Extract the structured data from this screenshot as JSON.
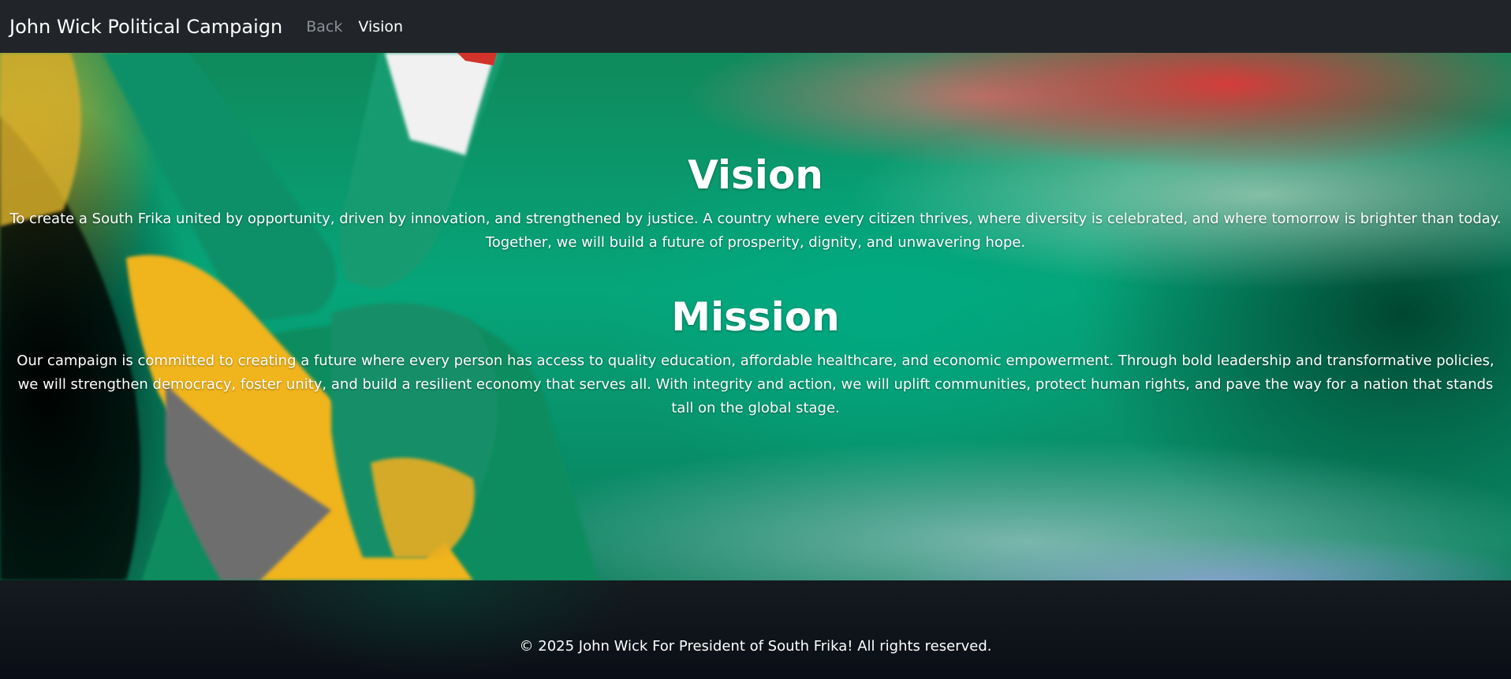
{
  "navbar": {
    "brand": "John Wick Political Campaign",
    "links": [
      {
        "label": "Back"
      },
      {
        "label": "Vision"
      }
    ]
  },
  "vision": {
    "title": "Vision",
    "text": "To create a South Frika united by opportunity, driven by innovation, and strengthened by justice. A country where every citizen thrives, where diversity is celebrated, and where tomorrow is brighter than today. Together, we will build a future of prosperity, dignity, and unwavering hope."
  },
  "mission": {
    "title": "Mission",
    "text": "Our campaign is committed to creating a future where every person has access to quality education, affordable healthcare, and economic empowerment. Through bold leadership and transformative policies, we will strengthen democracy, foster unity, and build a resilient economy that serves all. With integrity and action, we will uplift communities, protect human rights, and pave the way for a nation that stands tall on the global stage."
  },
  "footer": {
    "copyright": "© 2025 John Wick For President of South Frika! All rights reserved."
  },
  "colors": {
    "navbar_bg": "#212529",
    "link_muted": "#8c9196",
    "link_active": "#ffffff",
    "flag_green": "#007a4d",
    "flag_gold": "#ffb612",
    "flag_red": "#de3831",
    "flag_blue": "#002395"
  }
}
